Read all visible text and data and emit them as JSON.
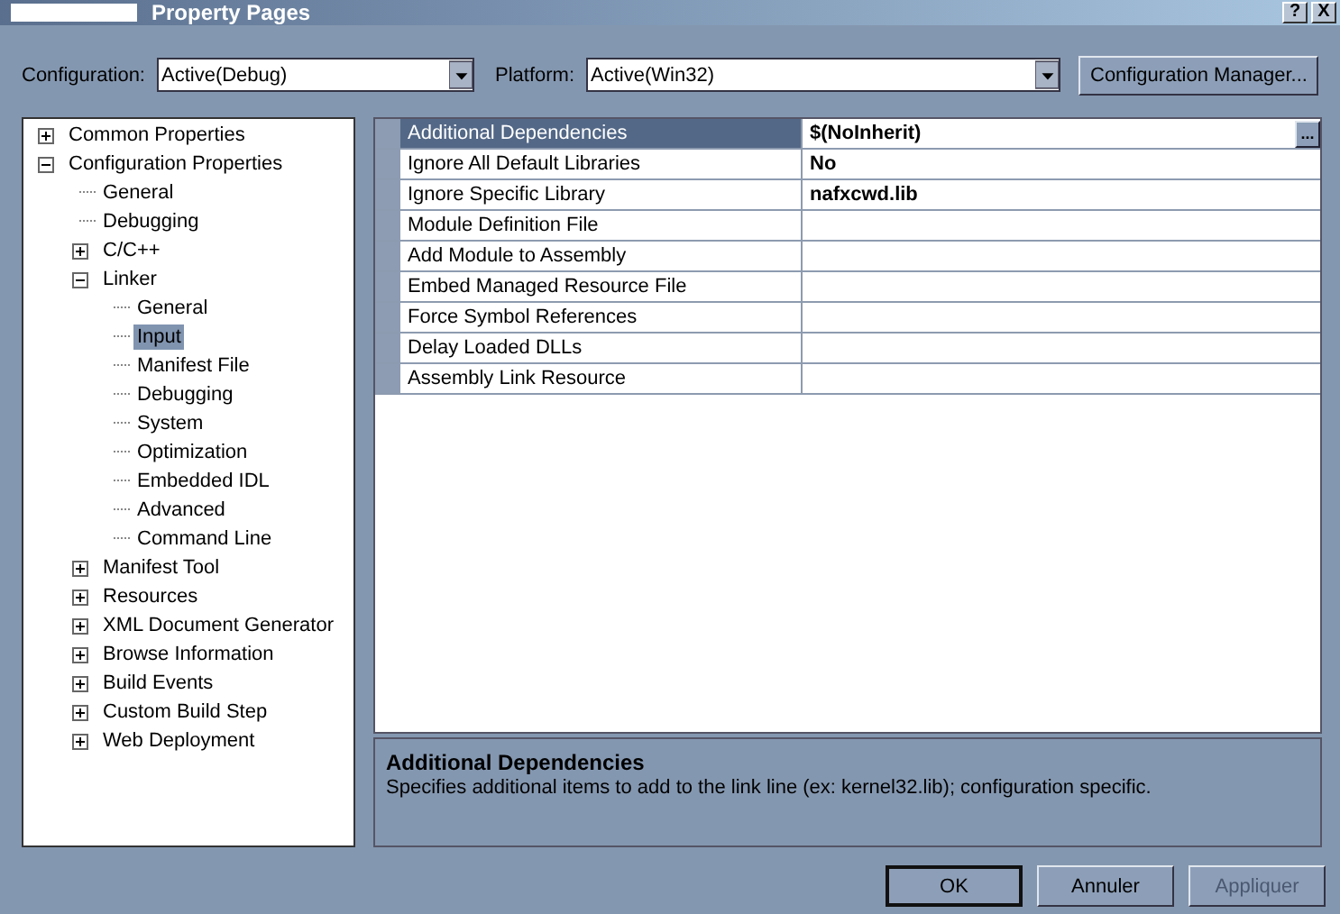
{
  "window": {
    "title": "Property Pages",
    "title_buttons": [
      "?",
      "X"
    ]
  },
  "toolbar": {
    "configuration": {
      "label": "Configuration:",
      "value": "Active(Debug)"
    },
    "platform": {
      "label": "Platform:",
      "value": "Active(Win32)"
    },
    "manager_button": "Configuration Manager..."
  },
  "tree": [
    {
      "label": "Common Properties",
      "kind": "group",
      "expanded": false,
      "selected": false
    },
    {
      "label": "Configuration Properties",
      "kind": "group",
      "expanded": true,
      "selected": false,
      "children": [
        {
          "label": "General",
          "kind": "leaf",
          "selected": false
        },
        {
          "label": "Debugging",
          "kind": "leaf",
          "selected": false
        },
        {
          "label": "C/C++",
          "kind": "group",
          "expanded": false,
          "selected": false
        },
        {
          "label": "Linker",
          "kind": "group",
          "expanded": true,
          "selected": false,
          "children": [
            {
              "label": "General",
              "kind": "leaf",
              "selected": false
            },
            {
              "label": "Input",
              "kind": "leaf",
              "selected": true
            },
            {
              "label": "Manifest File",
              "kind": "leaf",
              "selected": false
            },
            {
              "label": "Debugging",
              "kind": "leaf",
              "selected": false
            },
            {
              "label": "System",
              "kind": "leaf",
              "selected": false
            },
            {
              "label": "Optimization",
              "kind": "leaf",
              "selected": false
            },
            {
              "label": "Embedded IDL",
              "kind": "leaf",
              "selected": false
            },
            {
              "label": "Advanced",
              "kind": "leaf",
              "selected": false
            },
            {
              "label": "Command Line",
              "kind": "leaf",
              "selected": false
            }
          ]
        },
        {
          "label": "Manifest Tool",
          "kind": "group",
          "expanded": false,
          "selected": false
        },
        {
          "label": "Resources",
          "kind": "group",
          "expanded": false,
          "selected": false
        },
        {
          "label": "XML Document Generator",
          "kind": "group",
          "expanded": false,
          "selected": false
        },
        {
          "label": "Browse Information",
          "kind": "group",
          "expanded": false,
          "selected": false
        },
        {
          "label": "Build Events",
          "kind": "group",
          "expanded": false,
          "selected": false
        },
        {
          "label": "Custom Build Step",
          "kind": "group",
          "expanded": false,
          "selected": false
        },
        {
          "label": "Web Deployment",
          "kind": "group",
          "expanded": false,
          "selected": false
        }
      ]
    }
  ],
  "properties": [
    {
      "name": "Additional Dependencies",
      "value": "$(NoInherit)",
      "selected": true,
      "browse_button": "..."
    },
    {
      "name": "Ignore All Default Libraries",
      "value": "No",
      "selected": false
    },
    {
      "name": "Ignore Specific Library",
      "value": "nafxcwd.lib",
      "selected": false
    },
    {
      "name": "Module Definition File",
      "selected": false
    },
    {
      "name": "Add Module to Assembly",
      "selected": false
    },
    {
      "name": "Embed Managed Resource File",
      "selected": false
    },
    {
      "name": "Force Symbol References",
      "selected": false
    },
    {
      "name": "Delay Loaded DLLs",
      "selected": false
    },
    {
      "name": "Assembly Link Resource",
      "selected": false
    }
  ],
  "description": {
    "title": "Additional Dependencies",
    "text": "Specifies additional items to add to the link line (ex: kernel32.lib); configuration specific."
  },
  "buttons": [
    {
      "label": "OK",
      "default": true,
      "disabled": false
    },
    {
      "label": "Annuler",
      "default": false,
      "disabled": false
    },
    {
      "label": "Appliquer",
      "default": false,
      "disabled": true
    }
  ]
}
